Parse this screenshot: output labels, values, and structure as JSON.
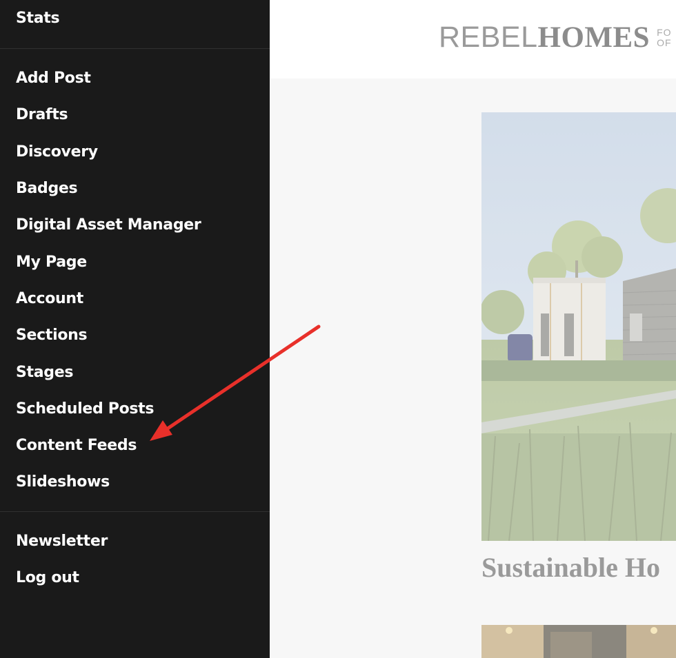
{
  "sidebar": {
    "stats_label": "Stats",
    "items": [
      {
        "label": "Add Post"
      },
      {
        "label": "Drafts"
      },
      {
        "label": "Discovery"
      },
      {
        "label": "Badges"
      },
      {
        "label": "Digital Asset Manager"
      },
      {
        "label": "My Page"
      },
      {
        "label": "Account"
      },
      {
        "label": "Sections"
      },
      {
        "label": "Stages"
      },
      {
        "label": "Scheduled Posts"
      },
      {
        "label": "Content Feeds"
      },
      {
        "label": "Slideshows"
      }
    ],
    "footer": [
      {
        "label": "Newsletter"
      },
      {
        "label": "Log out"
      }
    ]
  },
  "header": {
    "logo_light": "REBEL",
    "logo_bold": "HOMES",
    "tagline_line1": "FO",
    "tagline_line2": "OF"
  },
  "post": {
    "title": "Sustainable Ho"
  },
  "colors": {
    "sidebar_bg": "#1a1a1a",
    "annotation_arrow": "#e8302a"
  }
}
